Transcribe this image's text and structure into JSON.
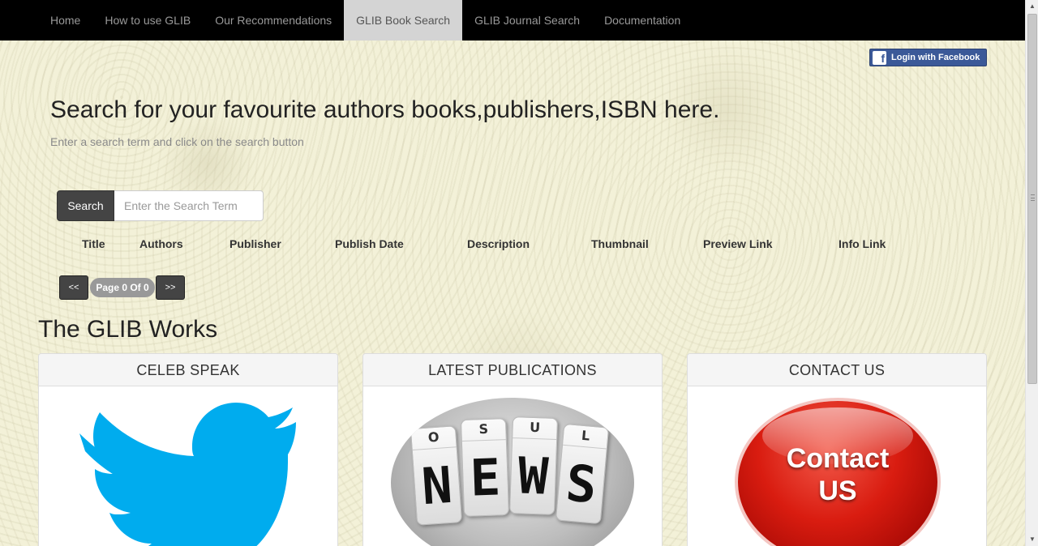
{
  "nav": {
    "items": [
      {
        "label": "Home"
      },
      {
        "label": "How to use GLIB"
      },
      {
        "label": "Our Recommendations"
      },
      {
        "label": "GLIB Book Search"
      },
      {
        "label": "GLIB Journal Search"
      },
      {
        "label": "Documentation"
      }
    ],
    "active": "GLIB Book Search"
  },
  "facebook": {
    "label": "Login with Facebook",
    "icon": "facebook-icon",
    "color": "#3b5998"
  },
  "hero": {
    "title": "Search for your favourite authors books,publishers,ISBN here.",
    "subtitle": "Enter a search term and click on the search button"
  },
  "search": {
    "button_label": "Search",
    "placeholder": "Enter the Search Term",
    "value": ""
  },
  "results_table": {
    "columns": [
      "Title",
      "Authors",
      "Publisher",
      "Publish Date",
      "Description",
      "Thumbnail",
      "Preview Link",
      "Info Link"
    ],
    "rows": []
  },
  "pager": {
    "prev_label": "<<",
    "next_label": ">>",
    "status": "Page 0 Of 0"
  },
  "works": {
    "title": "The GLIB Works",
    "panels": [
      {
        "heading": "CELEB SPEAK",
        "image": "twitter-bird-icon"
      },
      {
        "heading": "LATEST PUBLICATIONS",
        "image": "news-cubes",
        "cube_top_letters": [
          "O",
          "S",
          "U",
          "L"
        ],
        "cube_letters": [
          "N",
          "E",
          "W",
          "S"
        ]
      },
      {
        "heading": "CONTACT US",
        "image": "contact-us-button",
        "lines": [
          "Contact",
          "US"
        ]
      }
    ]
  },
  "colors": {
    "navbar_bg": "#000000",
    "nav_active_bg": "#d4d4d4",
    "button_dark": "#444444",
    "twitter_blue": "#00acee",
    "contact_red": "#d91c10",
    "page_bg": "#f3f1d8"
  }
}
